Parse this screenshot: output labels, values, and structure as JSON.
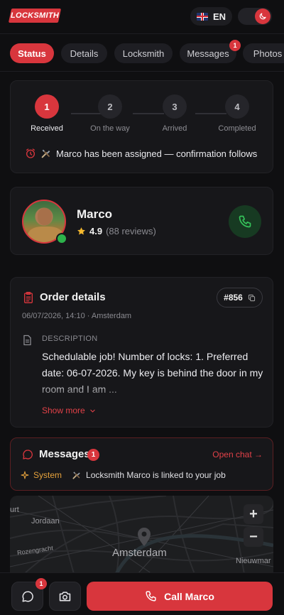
{
  "header": {
    "logo_text": "LOCKSMITH",
    "language": "EN",
    "flag_icon": "uk-flag-icon",
    "theme_icon": "moon-icon"
  },
  "tabs": [
    {
      "label": "Status",
      "active": true
    },
    {
      "label": "Details"
    },
    {
      "label": "Locksmith"
    },
    {
      "label": "Messages",
      "badge": "1"
    },
    {
      "label": "Photos"
    }
  ],
  "progress": {
    "steps": [
      {
        "number": "1",
        "label": "Received",
        "active": true
      },
      {
        "number": "2",
        "label": "On the way"
      },
      {
        "number": "3",
        "label": "Arrived"
      },
      {
        "number": "4",
        "label": "Completed"
      }
    ],
    "status_text": "Marco has been assigned — confirmation follows"
  },
  "locksmith": {
    "name": "Marco",
    "rating": "4.9",
    "reviews": "(88 reviews)",
    "online": true
  },
  "order": {
    "title": "Order details",
    "id": "#856",
    "meta": "06/07/2026, 14:10 · Amsterdam",
    "description_label": "DESCRIPTION",
    "description": "Schedulable job! Number of locks: 1. Preferred date: 06-07-2026. My key is behind the door in my room and I am ...",
    "show_more": "Show more"
  },
  "messages": {
    "title": "Messages",
    "badge": "1",
    "open_chat": "Open chat →",
    "sender": "System",
    "text": "Locksmith Marco is linked to your job"
  },
  "map": {
    "labels": [
      "Jordaan",
      "Amsterdam",
      "Nieuwmar",
      "Rozengracht",
      "urt"
    ],
    "zoom_in": "+",
    "zoom_out": "−"
  },
  "bottom_bar": {
    "chat_badge": "1",
    "call_label": "Call Marco"
  },
  "colors": {
    "accent": "#d8363d",
    "background": "#0f0f11",
    "card": "#17171a",
    "online": "#2db24b",
    "system": "#e6a23c"
  }
}
